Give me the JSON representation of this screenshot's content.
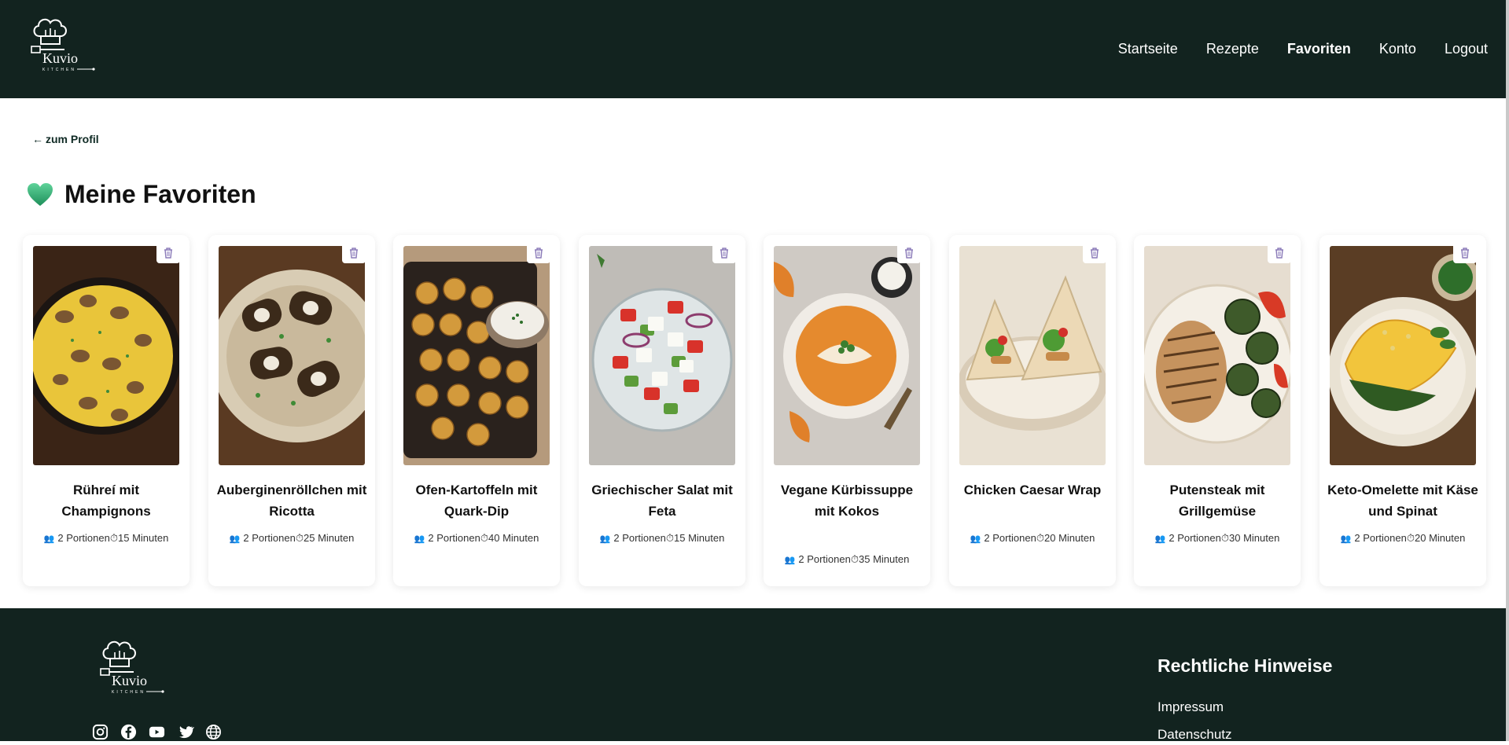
{
  "brand": {
    "name": "Kuvio",
    "sub": "KITCHEN"
  },
  "nav": [
    {
      "label": "Startseite",
      "active": false
    },
    {
      "label": "Rezepte",
      "active": false
    },
    {
      "label": "Favoriten",
      "active": true
    },
    {
      "label": "Konto",
      "active": false
    },
    {
      "label": "Logout",
      "active": false
    }
  ],
  "back": {
    "arrow": "←",
    "label": "zum Profil"
  },
  "page": {
    "title": "Meine Favoriten",
    "title_icon": "green-heart-icon"
  },
  "cards": [
    {
      "name": "Rühreí mit Champignons",
      "portions": "2 Portionen",
      "time": "15 Minuten",
      "image": "scrambled-eggs-mushrooms"
    },
    {
      "name": "Auberginenröllchen mit Ricotta",
      "portions": "2 Portionen",
      "time": "25 Minuten",
      "image": "eggplant-rolls"
    },
    {
      "name": "Ofen-Kartoffeln mit Quark-Dip",
      "portions": "2 Portionen",
      "time": "40 Minuten",
      "image": "roasted-potatoes"
    },
    {
      "name": "Griechischer Salat mit Feta",
      "portions": "2 Portionen",
      "time": "15 Minuten",
      "image": "greek-salad"
    },
    {
      "name": "Vegane Kürbissuppe mit Kokos",
      "portions": "2 Portionen",
      "time": "35 Minuten",
      "image": "pumpkin-soup"
    },
    {
      "name": "Chicken Caesar Wrap",
      "portions": "2 Portionen",
      "time": "20 Minuten",
      "image": "caesar-wrap"
    },
    {
      "name": "Putensteak mit Grillgemüse",
      "portions": "2 Portionen",
      "time": "30 Minuten",
      "image": "turkey-steak"
    },
    {
      "name": "Keto-Omelette mit Käse und Spinat",
      "portions": "2 Portionen",
      "time": "20 Minuten",
      "image": "keto-omelette"
    }
  ],
  "footer": {
    "social": [
      "instagram-icon",
      "facebook-icon",
      "youtube-icon",
      "twitter-icon",
      "globe-icon"
    ],
    "legal_title": "Rechtliche Hinweise",
    "legal_links": [
      "Impressum",
      "Datenschutz"
    ]
  },
  "colors": {
    "header_bg": "#12231f",
    "accent": "#2f8f5f",
    "trash": "#8a7ab8",
    "portion_icon": "#4b3a8a"
  }
}
